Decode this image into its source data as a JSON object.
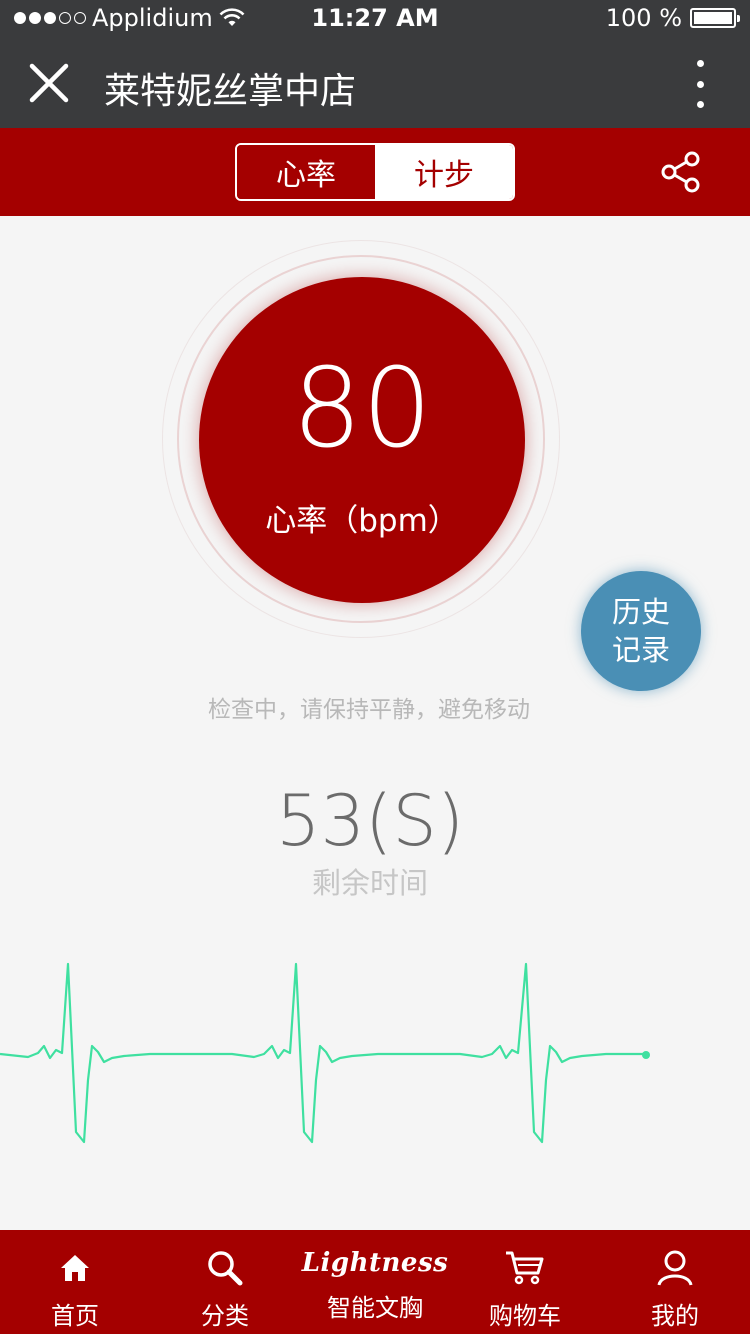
{
  "status_bar": {
    "carrier": "Applidium",
    "time": "11:27 AM",
    "battery": "100 %"
  },
  "nav": {
    "title": "莱特妮丝掌中店"
  },
  "segments": {
    "heart_rate": "心率",
    "steps": "计步"
  },
  "heart": {
    "value": "80",
    "unit": "心率（bpm）"
  },
  "history_button": {
    "line1": "历史",
    "line2": "记录"
  },
  "hint": "检查中，请保持平静，避免移动",
  "countdown": {
    "value": "53(S)",
    "label": "剩余时间"
  },
  "tabs": {
    "home": "首页",
    "category": "分类",
    "brand": "Lightness",
    "brand_label": "智能文胸",
    "cart": "购物车",
    "mine": "我的"
  },
  "colors": {
    "primary_red": "#a40000",
    "nav_dark": "#3a3b3d",
    "history_blue": "#4a8fb5",
    "ecg_line": "#3fe0a0"
  },
  "icons": [
    "close-icon",
    "more-icon",
    "share-icon",
    "home-icon",
    "search-icon",
    "cart-icon",
    "user-icon"
  ]
}
